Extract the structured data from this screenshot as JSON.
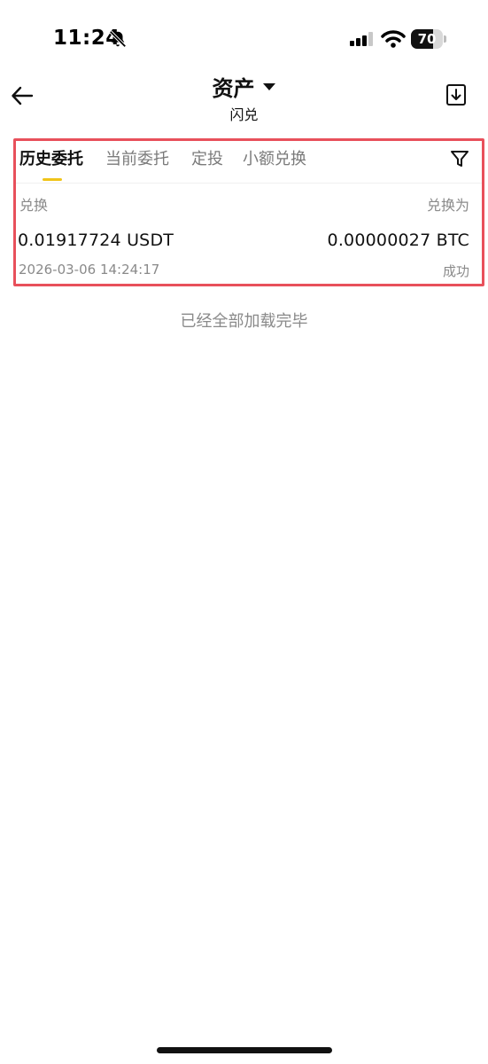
{
  "status_bar": {
    "time": "11:24",
    "battery_level": "70",
    "battery_fraction": 0.7,
    "bell_icon": "bell-slash-icon",
    "signal_icon": "cellular-signal-icon",
    "wifi_icon": "wifi-icon"
  },
  "header": {
    "title": "资产",
    "subtitle": "闪兑",
    "back_icon": "arrow-left-icon",
    "dropdown_icon": "caret-down-icon",
    "download_icon": "download-icon"
  },
  "tabs": [
    {
      "label": "历史委托",
      "active": true
    },
    {
      "label": "当前委托",
      "active": false
    },
    {
      "label": "定投",
      "active": false
    },
    {
      "label": "小额兑换",
      "active": false
    }
  ],
  "filter_icon": "filter-icon",
  "columns": {
    "from": "兑换",
    "to": "兑换为"
  },
  "records": [
    {
      "from_amount": "0.01917724 USDT",
      "to_amount": "0.00000027 BTC",
      "time": "2026-03-06 14:24:17",
      "status": "成功"
    }
  ],
  "end_note": "已经全部加载完毕",
  "colors": {
    "accent": "#f0c419",
    "highlight_border": "#e8505b",
    "muted_text": "#8a8a8a"
  }
}
